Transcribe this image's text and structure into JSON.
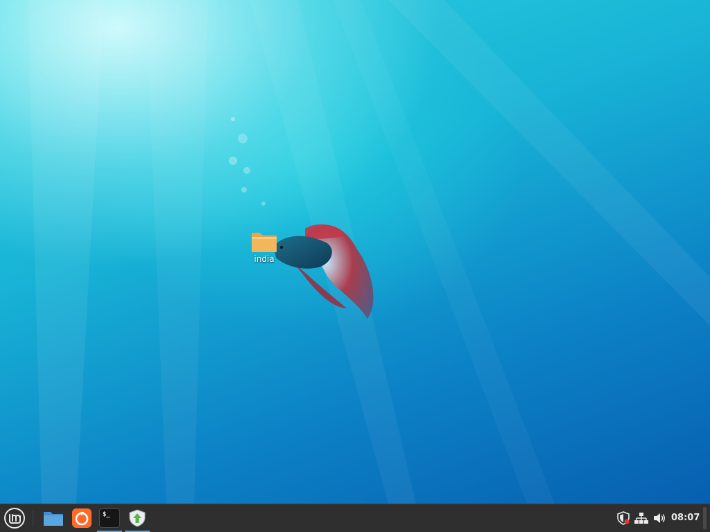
{
  "desktop": {
    "wallpaper": "underwater-betta-fish-icon",
    "icons": [
      {
        "label": "india",
        "icon": "folder-icon"
      }
    ]
  },
  "taskbar": {
    "menu_icon": "linux-mint-logo-icon",
    "launchers": [
      {
        "name": "files",
        "icon": "folder-icon"
      },
      {
        "name": "firefox",
        "icon": "firefox-icon"
      },
      {
        "name": "terminal",
        "icon": "terminal-icon",
        "text": "$_"
      },
      {
        "name": "update-manager",
        "icon": "shield-update-icon"
      }
    ],
    "tray": [
      "shield-alert-icon",
      "network-icon",
      "volume-icon"
    ],
    "clock": "08:07"
  },
  "colors": {
    "taskbar": "#2f2f2f",
    "folder": "#f4b65b",
    "files_icon": "#5aa7e0",
    "firefox": "#ff6a2a",
    "clock_text": "#eaeaea"
  }
}
